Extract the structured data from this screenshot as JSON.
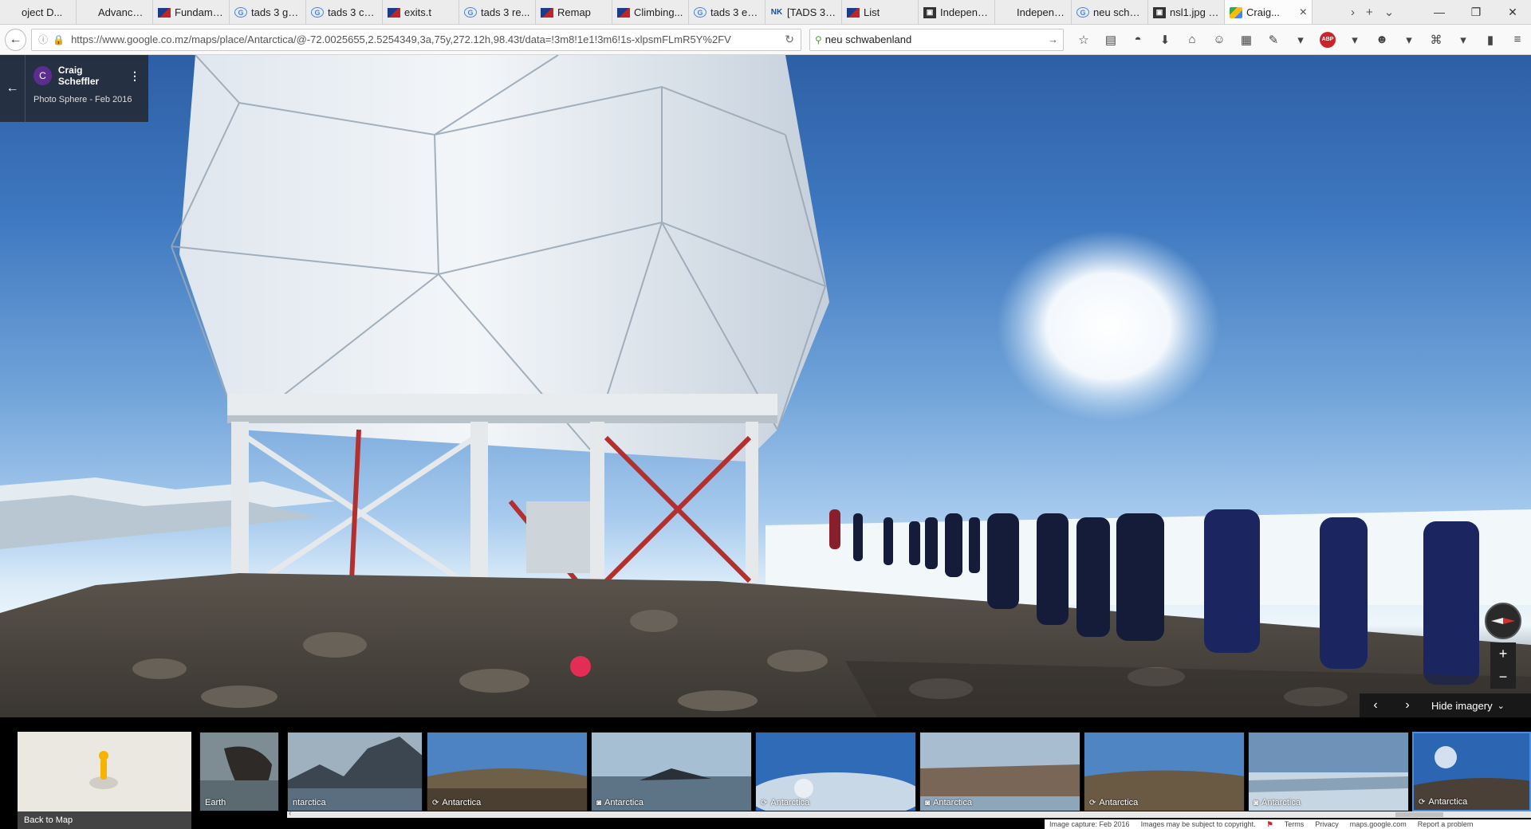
{
  "browser": {
    "tabs": [
      {
        "label": "oject D...",
        "icon": "blank"
      },
      {
        "label": "Advanced TA...",
        "icon": "blank"
      },
      {
        "label": "Fundame...",
        "icon": "flag"
      },
      {
        "label": "tads 3 get...",
        "icon": "g"
      },
      {
        "label": "tads 3 co...",
        "icon": "g"
      },
      {
        "label": "exits.t",
        "icon": "flag"
      },
      {
        "label": "tads 3 re...",
        "icon": "g"
      },
      {
        "label": "Remap",
        "icon": "flag"
      },
      {
        "label": "Climbing...",
        "icon": "flag"
      },
      {
        "label": "tads 3 exe...",
        "icon": "g"
      },
      {
        "label": "[TADS 3] ...",
        "icon": "nk"
      },
      {
        "label": "List",
        "icon": "flag"
      },
      {
        "label": "Independ...",
        "icon": "doc"
      },
      {
        "label": "Independent ...",
        "icon": "blank"
      },
      {
        "label": "neu schw...",
        "icon": "g"
      },
      {
        "label": "nsl1.jpg (...",
        "icon": "doc"
      },
      {
        "label": "Craig...",
        "icon": "maps",
        "active": true
      }
    ],
    "url": "https://www.google.co.mz/maps/place/Antarctica/@-72.0025655,2.5254349,3a,75y,272.12h,98.43t/data=!3m8!1e1!3m6!1s-xlpsmFLmR5Y%2FV",
    "search_value": "neu schwabenland"
  },
  "photosphere": {
    "author_name": "Craig Scheffler",
    "author_initial": "C",
    "subtitle": "Photo Sphere - Feb 2016",
    "hide_imagery": "Hide imagery",
    "colors": {
      "sky_top": "#2d5fa6",
      "dome": "#e9edf2",
      "rock": "#5e5850"
    }
  },
  "filmstrip": {
    "back_to_map": "Back to Map",
    "thumbs": [
      {
        "label": "Earth",
        "icon": ""
      },
      {
        "label": "ntarctica",
        "icon": ""
      },
      {
        "label": "Antarctica",
        "icon": "360"
      },
      {
        "label": "Antarctica",
        "icon": "cam"
      },
      {
        "label": "Antarctica",
        "icon": "360"
      },
      {
        "label": "Antarctica",
        "icon": "cam"
      },
      {
        "label": "Antarctica",
        "icon": "360"
      },
      {
        "label": "Antarctica",
        "icon": "cam"
      },
      {
        "label": "Antarctica",
        "icon": "360"
      }
    ]
  },
  "footer": {
    "capture": "Image capture: Feb 2016",
    "copyright": "Images may be subject to copyright.",
    "terms": "Terms",
    "privacy": "Privacy",
    "domain": "maps.google.com",
    "report": "Report a problem"
  }
}
